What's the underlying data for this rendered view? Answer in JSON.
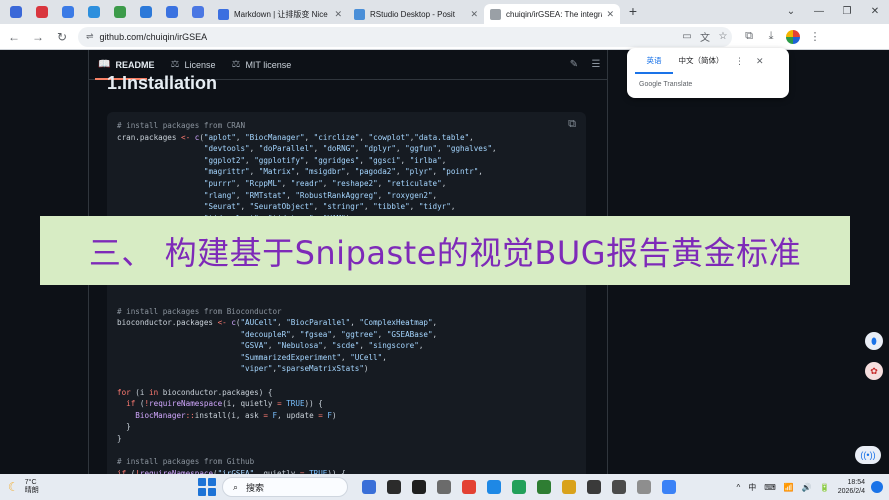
{
  "browser": {
    "pinned_tab_colors": [
      "#3a68d8",
      "#d9363e",
      "#3b7be6",
      "#2d8fdd",
      "#3c9b4a",
      "#2c79d9",
      "#3a72e0",
      "#4a77e3"
    ],
    "tabs": [
      {
        "title": "Markdown | 让排版变 Nice",
        "icon_color": "#3b6fe0",
        "active": false
      },
      {
        "title": "RStudio Desktop - Posit",
        "icon_color": "#4a8fd8",
        "active": false
      },
      {
        "title": "chuiqin/irGSEA: The integrati",
        "icon_color": "#9aa0a6",
        "active": true
      }
    ],
    "new_tab": "+",
    "window_controls": [
      "⌄",
      "—",
      "❐",
      "✕"
    ],
    "nav": {
      "back": "←",
      "forward": "→",
      "reload": "↻"
    },
    "url": "github.com/chuiqin/irGSEA",
    "url_icon": "⇌"
  },
  "readme": {
    "tabs": [
      {
        "icon": "📖",
        "label": "README",
        "active": true
      },
      {
        "icon": "⚖",
        "label": "License",
        "active": false
      },
      {
        "icon": "⚖",
        "label": "MIT license",
        "active": false
      }
    ],
    "edit_icon": "✎",
    "toc_icon": "☰",
    "heading": "1.Installation",
    "copy_icon": "⧉"
  },
  "code_lines": [
    [
      [
        "cm",
        "# install packages from CRAN"
      ]
    ],
    [
      [
        "",
        "cran.packages "
      ],
      [
        "kw",
        "<-"
      ],
      [
        "",
        " "
      ],
      [
        "fn",
        "c"
      ],
      [
        "",
        "("
      ],
      [
        "st",
        "\"aplot\""
      ],
      [
        "",
        ", "
      ],
      [
        "st",
        "\"BiocManager\""
      ],
      [
        "",
        ", "
      ],
      [
        "st",
        "\"circlize\""
      ],
      [
        "",
        ", "
      ],
      [
        "st",
        "\"cowplot\""
      ],
      [
        "",
        ","
      ],
      [
        "st",
        "\"data.table\""
      ],
      [
        "",
        ","
      ]
    ],
    [
      [
        "",
        "                   "
      ],
      [
        "st",
        "\"devtools\""
      ],
      [
        "",
        ", "
      ],
      [
        "st",
        "\"doParallel\""
      ],
      [
        "",
        ", "
      ],
      [
        "st",
        "\"doRNG\""
      ],
      [
        "",
        ", "
      ],
      [
        "st",
        "\"dplyr\""
      ],
      [
        "",
        ", "
      ],
      [
        "st",
        "\"ggfun\""
      ],
      [
        "",
        ", "
      ],
      [
        "st",
        "\"gghalves\""
      ],
      [
        "",
        ","
      ]
    ],
    [
      [
        "",
        "                   "
      ],
      [
        "st",
        "\"ggplot2\""
      ],
      [
        "",
        ", "
      ],
      [
        "st",
        "\"ggplotify\""
      ],
      [
        "",
        ", "
      ],
      [
        "st",
        "\"ggridges\""
      ],
      [
        "",
        ", "
      ],
      [
        "st",
        "\"ggsci\""
      ],
      [
        "",
        ", "
      ],
      [
        "st",
        "\"irlba\""
      ],
      [
        "",
        ","
      ]
    ],
    [
      [
        "",
        "                   "
      ],
      [
        "st",
        "\"magrittr\""
      ],
      [
        "",
        ", "
      ],
      [
        "st",
        "\"Matrix\""
      ],
      [
        "",
        ", "
      ],
      [
        "st",
        "\"msigdbr\""
      ],
      [
        "",
        ", "
      ],
      [
        "st",
        "\"pagoda2\""
      ],
      [
        "",
        ", "
      ],
      [
        "st",
        "\"plyr\""
      ],
      [
        "",
        ", "
      ],
      [
        "st",
        "\"pointr\""
      ],
      [
        "",
        ","
      ]
    ],
    [
      [
        "",
        "                   "
      ],
      [
        "st",
        "\"purrr\""
      ],
      [
        "",
        ", "
      ],
      [
        "st",
        "\"RcppML\""
      ],
      [
        "",
        ", "
      ],
      [
        "st",
        "\"readr\""
      ],
      [
        "",
        ", "
      ],
      [
        "st",
        "\"reshape2\""
      ],
      [
        "",
        ", "
      ],
      [
        "st",
        "\"reticulate\""
      ],
      [
        "",
        ","
      ]
    ],
    [
      [
        "",
        "                   "
      ],
      [
        "st",
        "\"rlang\""
      ],
      [
        "",
        ", "
      ],
      [
        "st",
        "\"RMTstat\""
      ],
      [
        "",
        ", "
      ],
      [
        "st",
        "\"RobustRankAggreg\""
      ],
      [
        "",
        ", "
      ],
      [
        "st",
        "\"roxygen2\""
      ],
      [
        "",
        ","
      ]
    ],
    [
      [
        "",
        "                   "
      ],
      [
        "st",
        "\"Seurat\""
      ],
      [
        "",
        ", "
      ],
      [
        "st",
        "\"SeuratObject\""
      ],
      [
        "",
        ", "
      ],
      [
        "st",
        "\"stringr\""
      ],
      [
        "",
        ", "
      ],
      [
        "st",
        "\"tibble\""
      ],
      [
        "",
        ", "
      ],
      [
        "st",
        "\"tidyr\""
      ],
      [
        "",
        ","
      ]
    ],
    [
      [
        "",
        "                   "
      ],
      [
        "st",
        "\"tidyselect\""
      ],
      [
        "",
        ", "
      ],
      [
        "st",
        "\"tidytree\""
      ],
      [
        "",
        ", "
      ],
      [
        "st",
        "\"VAM\""
      ],
      [
        "",
        ")"
      ]
    ],
    [
      [
        "",
        " "
      ]
    ],
    [
      [
        "",
        " "
      ]
    ],
    [
      [
        "",
        " "
      ]
    ],
    [
      [
        "",
        " "
      ]
    ],
    [
      [
        "",
        " "
      ]
    ],
    [
      [
        "",
        " "
      ]
    ],
    [
      [
        "",
        " "
      ]
    ],
    [
      [
        "cm",
        "# install packages from Bioconductor"
      ]
    ],
    [
      [
        "",
        "bioconductor.packages "
      ],
      [
        "kw",
        "<-"
      ],
      [
        "",
        " "
      ],
      [
        "fn",
        "c"
      ],
      [
        "",
        "("
      ],
      [
        "st",
        "\"AUCell\""
      ],
      [
        "",
        ", "
      ],
      [
        "st",
        "\"BiocParallel\""
      ],
      [
        "",
        ", "
      ],
      [
        "st",
        "\"ComplexHeatmap\""
      ],
      [
        "",
        ","
      ]
    ],
    [
      [
        "",
        "                           "
      ],
      [
        "st",
        "\"decoupleR\""
      ],
      [
        "",
        ", "
      ],
      [
        "st",
        "\"fgsea\""
      ],
      [
        "",
        ", "
      ],
      [
        "st",
        "\"ggtree\""
      ],
      [
        "",
        ", "
      ],
      [
        "st",
        "\"GSEABase\""
      ],
      [
        "",
        ","
      ]
    ],
    [
      [
        "",
        "                           "
      ],
      [
        "st",
        "\"GSVA\""
      ],
      [
        "",
        ", "
      ],
      [
        "st",
        "\"Nebulosa\""
      ],
      [
        "",
        ", "
      ],
      [
        "st",
        "\"scde\""
      ],
      [
        "",
        ", "
      ],
      [
        "st",
        "\"singscore\""
      ],
      [
        "",
        ","
      ]
    ],
    [
      [
        "",
        "                           "
      ],
      [
        "st",
        "\"SummarizedExperiment\""
      ],
      [
        "",
        ", "
      ],
      [
        "st",
        "\"UCell\""
      ],
      [
        "",
        ","
      ]
    ],
    [
      [
        "",
        "                           "
      ],
      [
        "st",
        "\"viper\""
      ],
      [
        "",
        ","
      ],
      [
        "st",
        "\"sparseMatrixStats\""
      ],
      [
        "",
        ")"
      ]
    ],
    [
      [
        "",
        " "
      ]
    ],
    [
      [
        "kw",
        "for"
      ],
      [
        "",
        " (i "
      ],
      [
        "kw",
        "in"
      ],
      [
        "",
        " bioconductor.packages) {"
      ]
    ],
    [
      [
        "",
        "  "
      ],
      [
        "kw",
        "if"
      ],
      [
        "",
        " ("
      ],
      [
        "kw",
        "!"
      ],
      [
        "fn",
        "requireNamespace"
      ],
      [
        "",
        "(i, quietly "
      ],
      [
        "kw",
        "="
      ],
      [
        "",
        " "
      ],
      [
        "cs",
        "TRUE"
      ],
      [
        "",
        ")) {"
      ]
    ],
    [
      [
        "",
        "    "
      ],
      [
        "fn",
        "BiocManager"
      ],
      [
        "kw",
        "::"
      ],
      [
        "",
        "install(i, ask "
      ],
      [
        "kw",
        "="
      ],
      [
        "",
        " "
      ],
      [
        "cs",
        "F"
      ],
      [
        "",
        ", update "
      ],
      [
        "kw",
        "="
      ],
      [
        "",
        " "
      ],
      [
        "cs",
        "F"
      ],
      [
        "",
        ")"
      ]
    ],
    [
      [
        "",
        "  }"
      ]
    ],
    [
      [
        "",
        "}"
      ]
    ],
    [
      [
        "",
        " "
      ]
    ],
    [
      [
        "cm",
        "# install packages from Github"
      ]
    ],
    [
      [
        "kw",
        "if"
      ],
      [
        "",
        " ("
      ],
      [
        "kw",
        "!"
      ],
      [
        "fn",
        "requireNamespace"
      ],
      [
        "",
        "("
      ],
      [
        "st",
        "\"irGSEA\""
      ],
      [
        "",
        ", quietly "
      ],
      [
        "kw",
        "="
      ],
      [
        "",
        " "
      ],
      [
        "cs",
        "TRUE"
      ],
      [
        "",
        ")) {"
      ]
    ]
  ],
  "translate_popup": {
    "lang_source": "英语",
    "lang_target": "中文（简体）",
    "menu_icon": "⋮",
    "close_icon": "✕",
    "brand": "Google Translate"
  },
  "banner": {
    "text": "三、 构建基于Snipaste的视觉BUG报告黄金标准",
    "bg": "#d7ecc4",
    "color": "#7e2ab8"
  },
  "taskbar": {
    "weather_temp": "7°C",
    "weather_desc": "晴朗",
    "search_label": "搜索",
    "app_colors": [
      "#3a6fd8",
      "#2b2b2b",
      "#1f1f1f",
      "#6b6b6b",
      "#e34133",
      "#1e88e5",
      "#22a05a",
      "#2e7d32",
      "#d9a21b",
      "#3a3a3a",
      "#4b4b4b",
      "#8e8e8e",
      "#3b82f6"
    ],
    "tray_caret": "^",
    "tray_ime": "中",
    "tray_icons": [
      "⌨",
      "📶",
      "🔊",
      "🔋"
    ],
    "time": "18:54",
    "date": "2026/2/4"
  }
}
